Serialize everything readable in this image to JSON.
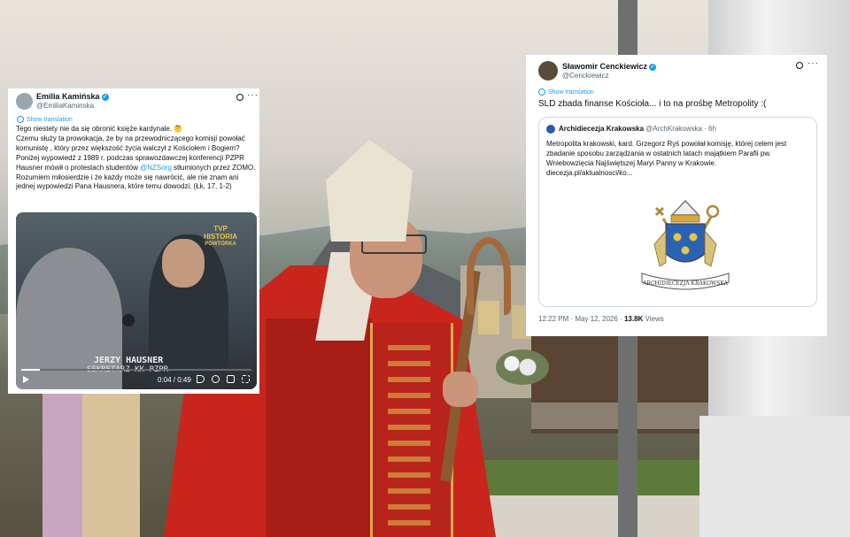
{
  "background": {
    "description_colors": {
      "robe": "#c8261d",
      "sky": "#e9e4dc"
    }
  },
  "left_tweet": {
    "author_name": "Emilia Kamińska",
    "author_handle": "@EmiliaKaminska",
    "show_translation": "Show translation",
    "body": [
      "Tego niestety nie da się obronić księże kardynale. 🤔",
      "Czemu służy ta prowokacja, że by na przewodniczącego komisji powołać komunistę , który przez większość życia walczył z Kościołem i Bogiem?",
      "Poniżej wypowiedź z 1989 r. podczas sprawozdawczej konferencji PZPR Hausner mówił o protestach studentów",
      "@NZSorg",
      "stłumionych przez ZOMO.",
      "Rozumiem miłosierdzie i że każdy może się nawrócić, ale nie znam ani jednej wypowiedzi Pana Hausnera, które temu dowodzi. (Łk, 17, 1-2)"
    ],
    "video": {
      "channel_logo_line1": "TVP",
      "channel_logo_line2": "HISTORIA",
      "channel_logo_line3": "POWTÓRKA",
      "caption_name": "JERZY HAUSNER",
      "caption_title": "SEKRETARZ KK PZPR",
      "time": "0:04 / 0:49",
      "progress": 0.08
    }
  },
  "right_tweet": {
    "author_name": "Sławomir Cenckiewicz",
    "author_handle": "@Cenckiewicz",
    "show_translation": "Show translation",
    "text": "SLD zbada finanse Kościoła... i to na prośbę Metropolity :(",
    "quote": {
      "author_name": "Archidiecezja Krakowska",
      "author_handle": "@ArchKrakowska",
      "age": "· 6h",
      "lines": [
        "Metropolita krakowski, kard. Grzegorz Ryś powołał komisję, której celem jest",
        "zbadanie sposobu zarządzania w ostatnich latach majątkiem Parafii pw.",
        "Wniebowzięcia Najświętszej Maryi Panny w Krakowie.",
        "diecezja.pl/aktualnosci/ko..."
      ],
      "coat_of_arms_banner": "ARCHIDIECEZJA KRAKOWSKA"
    },
    "timestamp": "12:22 PM · May 12, 2026 ·",
    "views_count": "13.8K",
    "views_label": "Views"
  }
}
